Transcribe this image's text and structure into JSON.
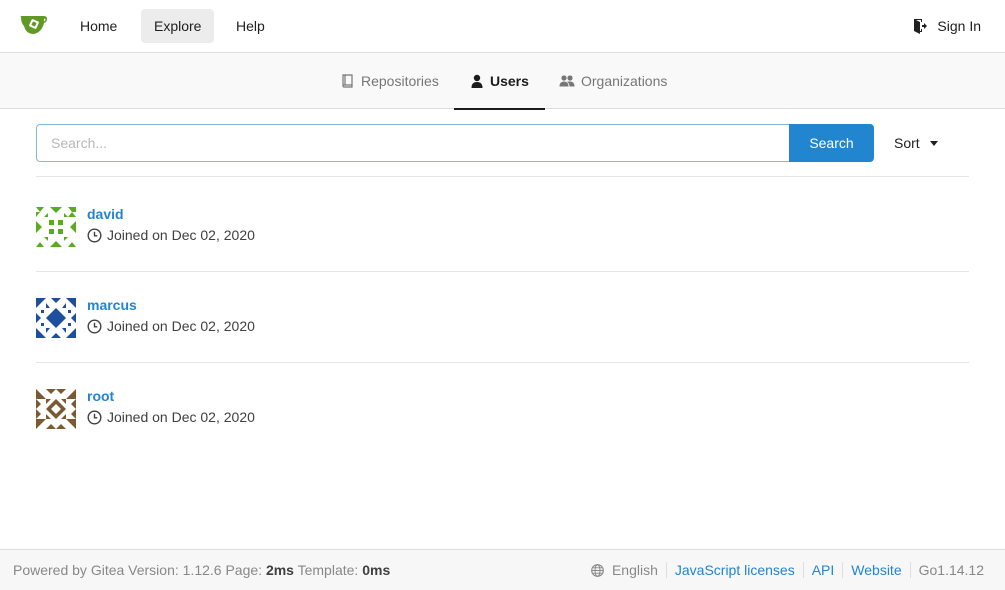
{
  "nav": {
    "logo_icon": "gitea-teacup-icon",
    "items": [
      {
        "label": "Home",
        "active": false
      },
      {
        "label": "Explore",
        "active": true
      },
      {
        "label": "Help",
        "active": false
      }
    ],
    "sign_in": "Sign In"
  },
  "tabs": [
    {
      "label": "Repositories",
      "icon": "book-icon",
      "active": false
    },
    {
      "label": "Users",
      "icon": "person-icon",
      "active": true
    },
    {
      "label": "Organizations",
      "icon": "organization-icon",
      "active": false
    }
  ],
  "search": {
    "placeholder": "Search...",
    "value": "",
    "button": "Search",
    "sort_label": "Sort"
  },
  "users": [
    {
      "name": "david",
      "joined": "Joined on Dec 02, 2020",
      "avatar_color": "#5aac1e"
    },
    {
      "name": "marcus",
      "joined": "Joined on Dec 02, 2020",
      "avatar_color": "#1e4e9e"
    },
    {
      "name": "root",
      "joined": "Joined on Dec 02, 2020",
      "avatar_color": "#7a5a32"
    }
  ],
  "footer": {
    "powered_by": "Powered by Gitea Version: 1.12.6 Page:",
    "page_time": "2ms",
    "template_label": "Template:",
    "template_time": "0ms",
    "language": "English",
    "links": [
      "JavaScript licenses",
      "API",
      "Website"
    ],
    "go_version": "Go1.14.12"
  },
  "colors": {
    "primary": "#2185d0",
    "logo_green": "#609926"
  }
}
